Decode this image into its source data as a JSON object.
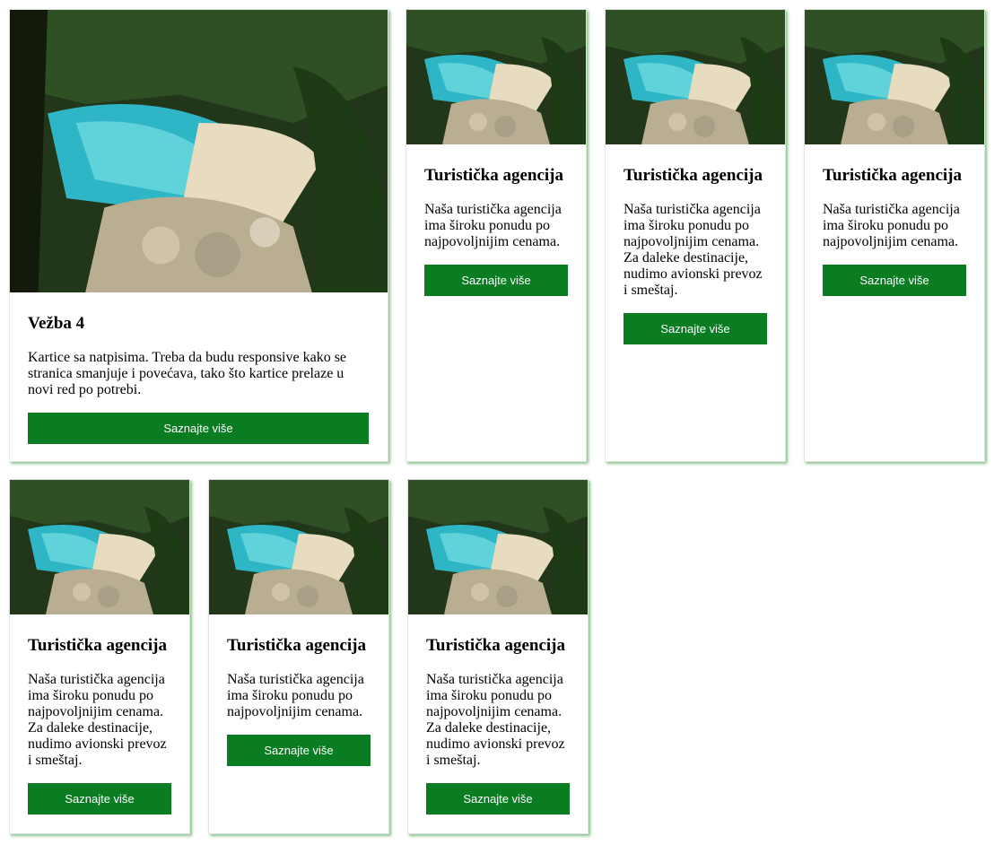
{
  "cards": [
    {
      "title": "Vežba 4",
      "text": "Kartice sa natpisima. Treba da budu responsive kako se stranica smanjuje i povećava, tako što kartice prelaze u novi red po potrebi.",
      "button": "Saznajte više"
    },
    {
      "title": "Turistička agencija",
      "text": "Naša turistička agencija ima široku ponudu po najpovoljnijim cenama.",
      "button": "Saznajte više"
    },
    {
      "title": "Turistička agencija",
      "text": "Naša turistička agencija ima široku ponudu po najpovoljnijim cenama. Za daleke destinacije, nudimo avionski prevoz i smeštaj.",
      "button": "Saznajte više"
    },
    {
      "title": "Turistička agencija",
      "text": "Naša turistička agencija ima široku ponudu po najpovoljnijim cenama.",
      "button": "Saznajte više"
    },
    {
      "title": "Turistička agencija",
      "text": "Naša turistička agencija ima široku ponudu po najpovoljnijim cenama. Za daleke destinacije, nudimo avionski prevoz i smeštaj.",
      "button": "Saznajte više"
    },
    {
      "title": "Turistička agencija",
      "text": "Naša turistička agencija ima široku ponudu po najpovoljnijim cenama.",
      "button": "Saznajte više"
    },
    {
      "title": "Turistička agencija",
      "text": "Naša turistička agencija ima široku ponudu po najpovoljnijim cenama. Za daleke destinacije, nudimo avionski prevoz i smeštaj.",
      "button": "Saznajte više"
    }
  ],
  "colors": {
    "button": "#0a7d22",
    "card_shadow": "#3c9c3c"
  },
  "image": "beach-cove-photo"
}
